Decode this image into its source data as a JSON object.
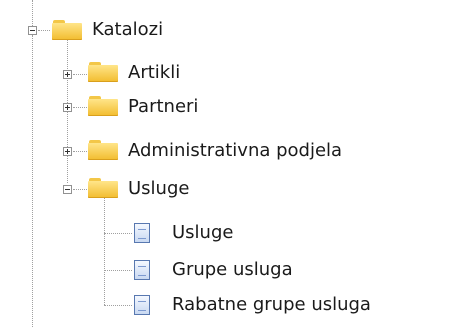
{
  "tree": {
    "root": {
      "label": "Katalozi",
      "icon": "folder-icon",
      "state": "expanded"
    },
    "children": [
      {
        "label": "Artikli",
        "icon": "folder-icon",
        "state": "collapsed"
      },
      {
        "label": "Partneri",
        "icon": "folder-icon",
        "state": "collapsed"
      },
      {
        "label": "Administrativna podjela",
        "icon": "folder-icon",
        "state": "collapsed"
      },
      {
        "label": "Usluge",
        "icon": "folder-icon",
        "state": "expanded",
        "children": [
          {
            "label": "Usluge",
            "icon": "document-icon"
          },
          {
            "label": "Grupe usluga",
            "icon": "document-icon"
          },
          {
            "label": "Rabatne grupe usluga",
            "icon": "document-icon"
          }
        ]
      }
    ]
  },
  "colors": {
    "folder": "#f2bc2e",
    "document": "#5878b0",
    "connector": "#a0a0a0",
    "text": "#1a1a1a",
    "background": "#ffffff"
  }
}
